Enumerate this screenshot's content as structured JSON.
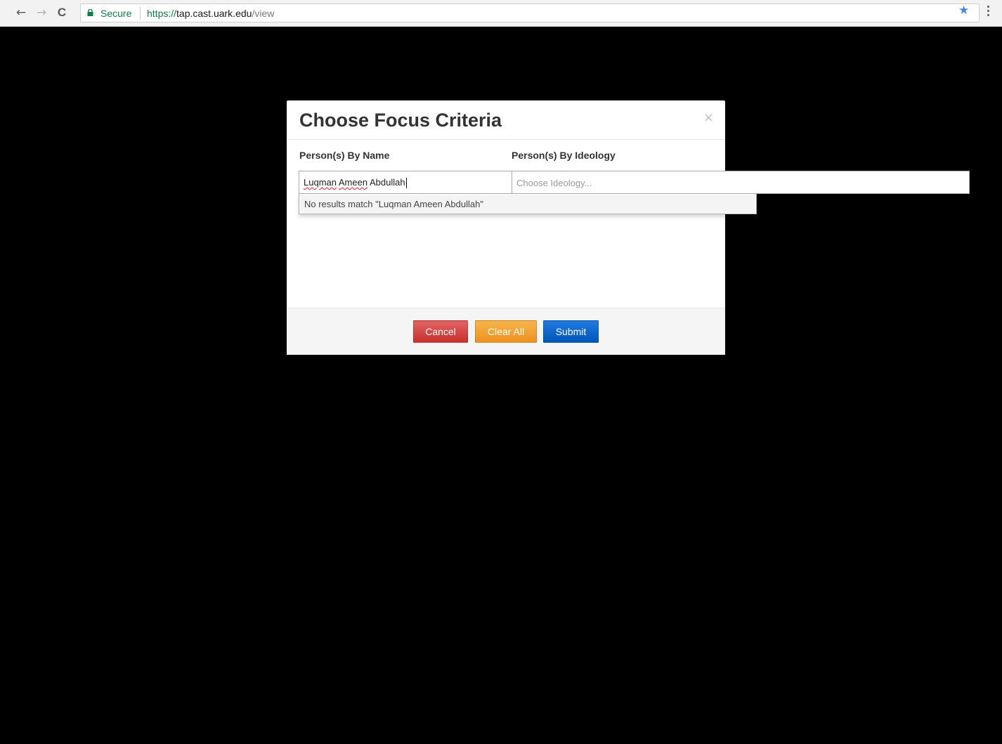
{
  "browser": {
    "secure_label": "Secure",
    "url_scheme": "https://",
    "url_host": "tap.cast.uark.edu",
    "url_path": "/view",
    "back_icon": "←",
    "forward_icon": "→",
    "reload_icon": "C",
    "star_icon": "★"
  },
  "modal": {
    "title": "Choose Focus Criteria",
    "close_icon": "×",
    "columns": [
      {
        "label": "Person(s) By Name"
      },
      {
        "label": "Person(s) By Ideology"
      }
    ],
    "name_field": {
      "value_parts": [
        "Luqman",
        "Ameen",
        "Abdullah"
      ]
    },
    "ideology_field": {
      "placeholder": "Choose Ideology..."
    },
    "dropdown": {
      "no_results_text": "No results match \"Luqman Ameen Abdullah\""
    },
    "buttons": {
      "cancel": "Cancel",
      "clear_all": "Clear All",
      "submit": "Submit"
    }
  },
  "colors": {
    "cancel": "#d9534f",
    "clear_all": "#f0ad4e",
    "submit": "#0a64c8",
    "overlay": "#000000",
    "secure_green": "#0b8043",
    "star_blue": "#4a86e8"
  }
}
